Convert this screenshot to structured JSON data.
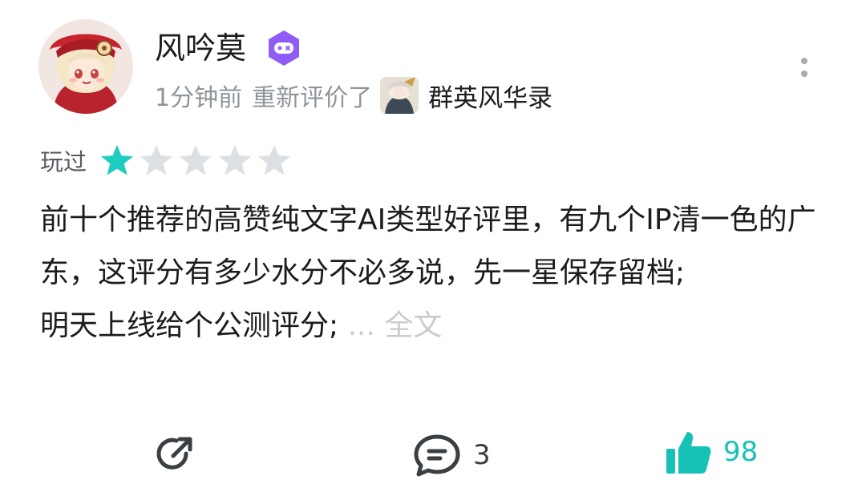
{
  "user": {
    "name": "风吟莫",
    "avatar_icon": "avatar-anime-girl",
    "badge_icon": "gamepad-badge-icon",
    "badge_color": "#8f5cf5"
  },
  "meta": {
    "time": "1分钟前",
    "action": "重新评价了",
    "game_icon": "game-cover-icon",
    "game_name": "群英风华录"
  },
  "rating": {
    "label": "玩过",
    "stars": 1,
    "max_stars": 5,
    "filled_color": "#1fcdc0",
    "empty_color": "#dcdfe3"
  },
  "review": {
    "lines": [
      "前十个推荐的高赞纯文字AI类型好评里，有九个IP清一色的广东，这评分有多少水分不必多说，先一星保存留档;",
      "明天上线给个公测评分;"
    ],
    "ellipsis": "...",
    "full_text_label": "全文"
  },
  "actions": {
    "share_icon": "share-icon",
    "comment_icon": "comment-icon",
    "comment_count": "3",
    "like_icon": "thumbs-up-icon",
    "like_count": "98",
    "accent_color": "#16c2b6"
  }
}
